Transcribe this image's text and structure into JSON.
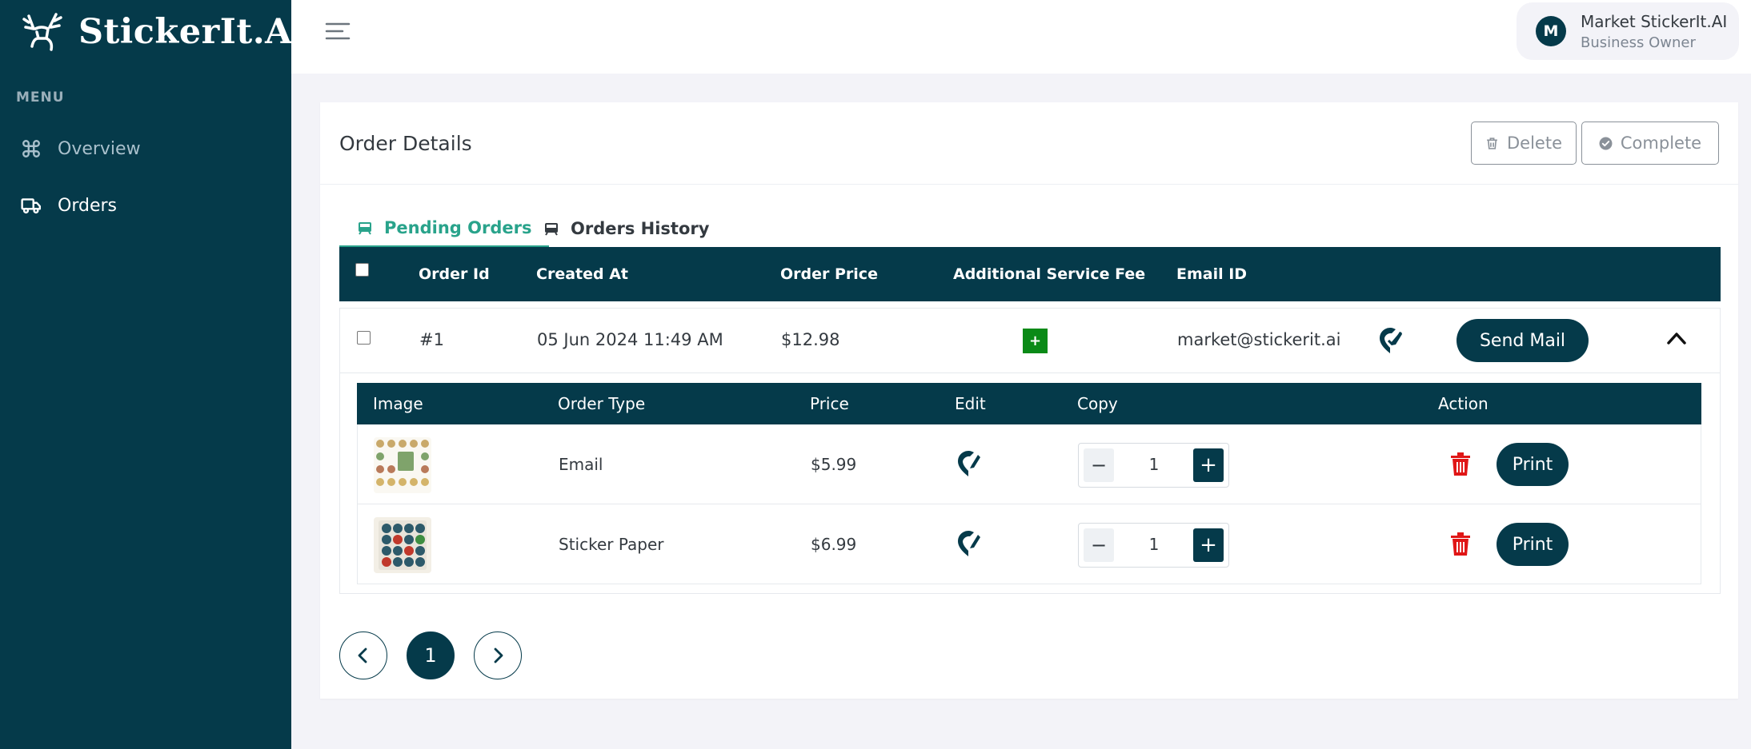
{
  "brand": {
    "name": "StickerIt.AI",
    "logo_icon": "moose-icon"
  },
  "sidebar": {
    "menu_title": "MENU",
    "items": [
      {
        "label": "Overview",
        "icon": "command-icon",
        "active": false
      },
      {
        "label": "Orders",
        "icon": "truck-icon",
        "active": true
      }
    ]
  },
  "topbar": {
    "user": {
      "initial": "M",
      "name": "Market StickerIt.AI",
      "role": "Business Owner"
    }
  },
  "card": {
    "title": "Order Details",
    "delete_label": "Delete",
    "complete_label": "Complete"
  },
  "tabs": [
    {
      "label": "Pending Orders",
      "active": true
    },
    {
      "label": "Orders History",
      "active": false
    }
  ],
  "orders_table": {
    "headers": [
      "Order Id",
      "Created At",
      "Order Price",
      "Additional Service Fee",
      "Email ID"
    ],
    "rows": [
      {
        "order_id": "#1",
        "created_at": "05 Jun 2024 11:49 AM",
        "order_price": "$12.98",
        "service_fee_symbol": "+",
        "email": "market@stickerit.ai",
        "send_label": "Send Mail"
      }
    ]
  },
  "items_table": {
    "headers": [
      "Image",
      "Order Type",
      "Price",
      "Edit",
      "Copy",
      "Action"
    ],
    "rows": [
      {
        "type": "Email",
        "price": "$5.99",
        "qty": "1",
        "print_label": "Print"
      },
      {
        "type": "Sticker Paper",
        "price": "$6.99",
        "qty": "1",
        "print_label": "Print"
      }
    ]
  },
  "pagination": {
    "current_page": "1"
  },
  "colors": {
    "primary": "#053a4a",
    "accent": "#29a38b",
    "danger": "#e01616",
    "success": "#0a8a17"
  }
}
